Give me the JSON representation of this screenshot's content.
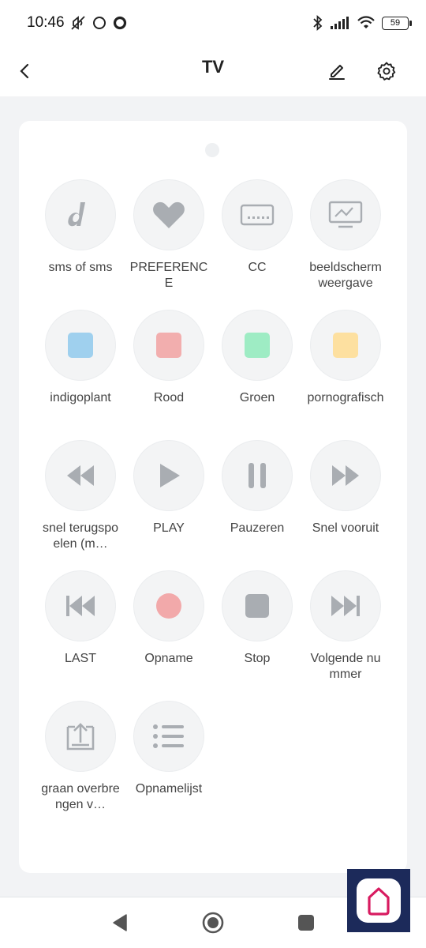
{
  "status_bar": {
    "time": "10:46",
    "battery": "59"
  },
  "header": {
    "title": "TV"
  },
  "buttons": [
    {
      "label": "sms of sms",
      "icon": "dish-logo-icon"
    },
    {
      "label": "PREFERENCE",
      "icon": "heart-icon"
    },
    {
      "label": "CC",
      "icon": "keyboard-icon"
    },
    {
      "label": "beeldschermweergave",
      "icon": "monitor-chart-icon"
    },
    {
      "label": "indigoplant",
      "icon": "blue-square-icon",
      "color": "#9fd0ee"
    },
    {
      "label": "Rood",
      "icon": "red-square-icon",
      "color": "#f2aeae"
    },
    {
      "label": "Groen",
      "icon": "green-square-icon",
      "color": "#9eecc4"
    },
    {
      "label": "pornografisch",
      "icon": "yellow-square-icon",
      "color": "#fde0a0"
    },
    {
      "label": "snel terugspoelen (m…",
      "icon": "rewind-icon"
    },
    {
      "label": "PLAY",
      "icon": "play-icon"
    },
    {
      "label": "Pauzeren",
      "icon": "pause-icon"
    },
    {
      "label": "Snel vooruit",
      "icon": "fast-forward-icon"
    },
    {
      "label": "LAST",
      "icon": "skip-previous-icon"
    },
    {
      "label": "Opname",
      "icon": "record-icon"
    },
    {
      "label": "Stop",
      "icon": "stop-icon"
    },
    {
      "label": "Volgende nummer",
      "icon": "skip-next-icon"
    },
    {
      "label": "graan overbrengen v…",
      "icon": "upload-icon"
    },
    {
      "label": "Opnamelijst",
      "icon": "list-icon"
    }
  ],
  "colors": {
    "icon_gray": "#a9adb2",
    "record_red": "#f2a9aa",
    "accent_dark": "#1c2a5a",
    "app_pink": "#d81b60"
  }
}
